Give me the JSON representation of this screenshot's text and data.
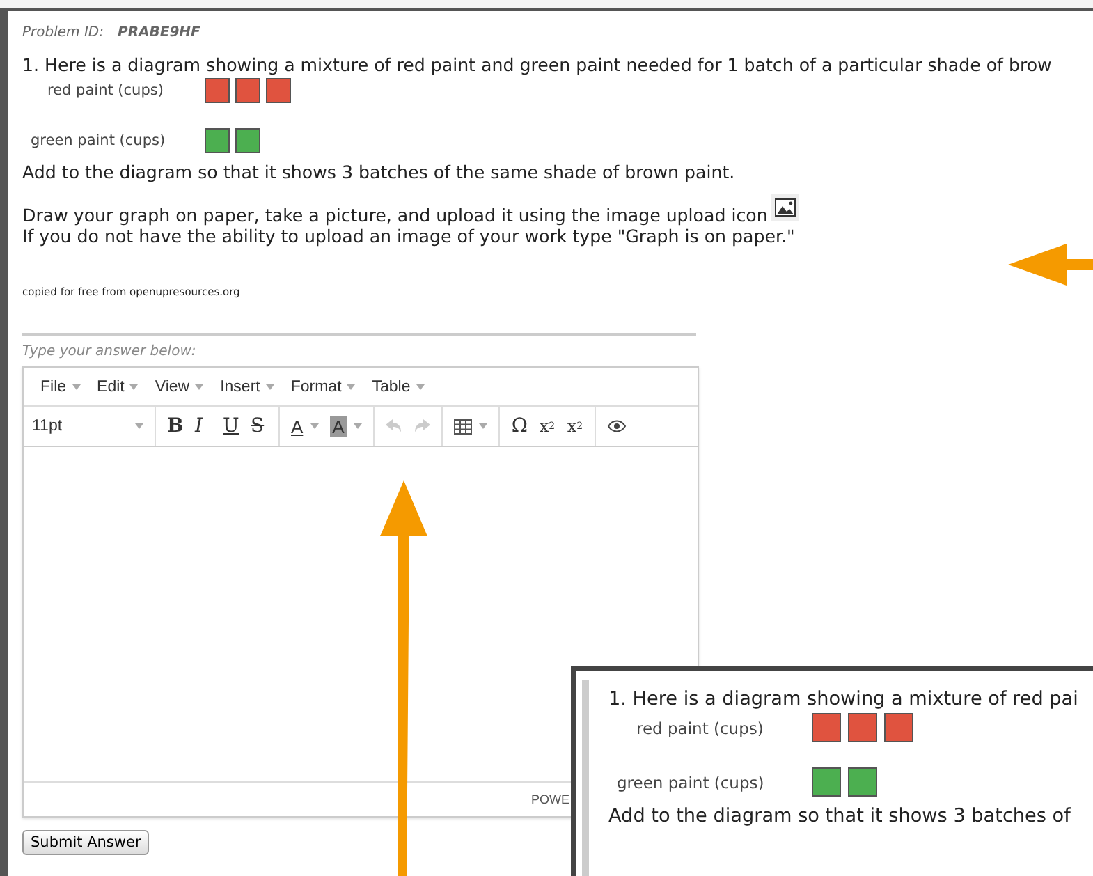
{
  "problem_id": {
    "label": "Problem ID:",
    "value": "PRABE9HF"
  },
  "question": {
    "prompt": "1. Here is a diagram showing a mixture of red paint and green paint needed for 1 batch of a particular shade of brow",
    "rows": [
      {
        "label": "red paint (cups)",
        "squares": [
          {
            "color": "#e0533f"
          },
          {
            "color": "#e0533f"
          },
          {
            "color": "#e0533f"
          }
        ]
      },
      {
        "label": "green paint (cups)",
        "squares": [
          {
            "color": "#4caf50"
          },
          {
            "color": "#4caf50"
          }
        ]
      }
    ],
    "task": "Add to the diagram so that it shows 3 batches of the same shade of brown paint.",
    "instructions": [
      "Draw your graph on paper, take a picture, and upload it using the image upload icon",
      "If you do not have the ability to upload an image of your work type \"Graph is on paper.\""
    ],
    "source": "copied for free from openupresources.org"
  },
  "answer_label": "Type your answer below:",
  "editor": {
    "menus": [
      "File",
      "Edit",
      "View",
      "Insert",
      "Format",
      "Table"
    ],
    "toolbar": [
      [
        {
          "kind": "select",
          "label": "11pt"
        }
      ],
      [
        {
          "kind": "bold",
          "label": "B"
        },
        {
          "kind": "italic",
          "label": "I"
        },
        {
          "kind": "underline",
          "label": "U"
        },
        {
          "kind": "strike",
          "label": "S"
        }
      ],
      [
        {
          "kind": "textcolor",
          "label": "A"
        },
        {
          "kind": "highlight",
          "label": "A"
        }
      ],
      [
        {
          "kind": "undo",
          "disabled": true
        },
        {
          "kind": "redo",
          "disabled": true
        }
      ],
      [
        {
          "kind": "table"
        }
      ],
      [
        {
          "kind": "symbol",
          "label": "Ω"
        },
        {
          "kind": "sub",
          "label": "x",
          "index": "2"
        },
        {
          "kind": "sup",
          "label": "x",
          "index": "2"
        }
      ],
      [
        {
          "kind": "preview"
        }
      ]
    ],
    "status": "POWE"
  },
  "submit": "Submit Answer",
  "inset": {
    "prompt": "1. Here is a diagram showing a mixture of red pai",
    "rows": [
      {
        "label": "red paint (cups)",
        "squares": [
          {
            "color": "#e0533f"
          },
          {
            "color": "#e0533f"
          },
          {
            "color": "#e0533f"
          }
        ]
      },
      {
        "label": "green paint (cups)",
        "squares": [
          {
            "color": "#4caf50"
          },
          {
            "color": "#4caf50"
          }
        ]
      }
    ],
    "task": "Add to the diagram so that it shows 3 batches of"
  }
}
